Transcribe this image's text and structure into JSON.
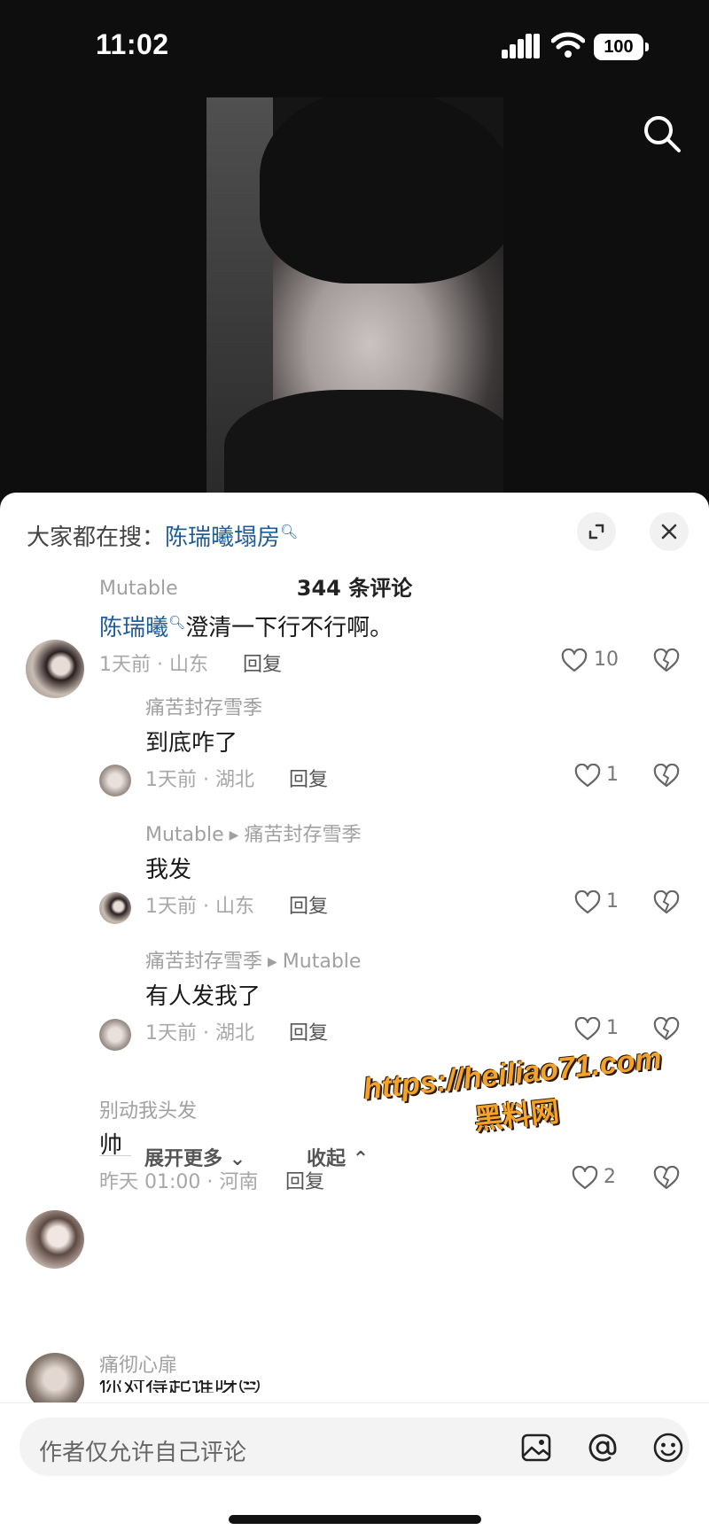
{
  "status_bar": {
    "time": "11:02",
    "battery": "100"
  },
  "sheet": {
    "trending_prefix": "大家都在搜：",
    "trending_term": "陈瑞曦塌房",
    "comment_count": "344 条评论"
  },
  "comments": [
    {
      "username": "Mutable",
      "mention": "陈瑞曦",
      "text": "澄清一下行不行啊。",
      "meta": "1天前 · 山东",
      "reply": "回复",
      "likes": "10"
    },
    {
      "username": "痛苦封存雪季",
      "text": "到底咋了",
      "meta": "1天前 · 湖北",
      "reply": "回复",
      "likes": "1"
    },
    {
      "username": "Mutable",
      "reply_to": "痛苦封存雪季",
      "text": "我发",
      "meta": "1天前 · 山东",
      "reply": "回复",
      "likes": "1"
    },
    {
      "username": "痛苦封存雪季",
      "reply_to": "Mutable",
      "text": "有人发我了",
      "meta": "1天前 · 湖北",
      "reply": "回复",
      "likes": "1"
    },
    {
      "username": "别动我头发",
      "text": "帅",
      "meta": "昨天 01:00 · 河南",
      "reply": "回复",
      "likes": "2"
    },
    {
      "username": "痛彻心扉",
      "text": "你对得起谁呀😒"
    }
  ],
  "thread": {
    "expand_more": "展开更多",
    "collapse": "收起"
  },
  "watermark": {
    "url": "https://heiliao71.com",
    "name": "黑料网"
  },
  "input": {
    "placeholder": "作者仅允许自己评论"
  },
  "colors": {
    "link": "#1f5d99",
    "watermark": "#f3a22a"
  }
}
